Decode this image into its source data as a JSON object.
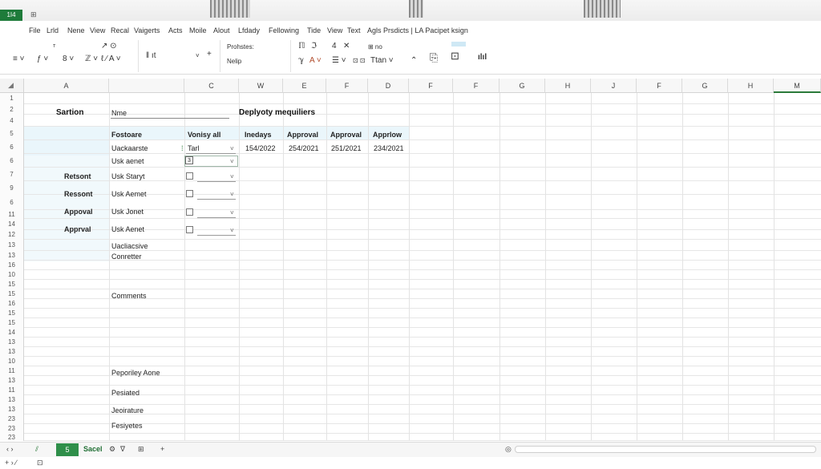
{
  "app": {
    "badge": "1I4",
    "grid_icon": "⊞"
  },
  "menu": [
    "File",
    "Lrld",
    "Nene",
    "View",
    "Recal",
    "Vaigerts",
    "Acts",
    "Moile",
    "Alout",
    "Lfdady",
    "Fellowing",
    "Tide",
    "View",
    "Text",
    "Agls Prsdicts | LA Pacipet ksign"
  ],
  "ribbon": {
    "g1": [
      "≡ ˅",
      "ƒ ˅",
      "8 ˅",
      "ℤ ˅"
    ],
    "g1_top": [
      "ᵀ",
      "↗ ⊙",
      "ℓ ∕ A ˅"
    ],
    "g2": [
      "‖ ıt",
      "˅",
      "+"
    ],
    "g3_top": "Prohstes:",
    "g3_bot": "Nelip",
    "g4_top": [
      "ℿ",
      "ℑ",
      "4",
      "✕",
      "⊞ no"
    ],
    "g4_bot": [
      "ℽ",
      "A ˅",
      "☰ ˅",
      "⊡ ⊡",
      "Ttan ˅",
      "⌃"
    ],
    "icons": [
      "⎘",
      "⊡",
      "ılıl"
    ]
  },
  "columns": [
    "A",
    "C",
    "W",
    "E",
    "F",
    "D",
    "F",
    "F",
    "G",
    "H",
    "J",
    "F",
    "G",
    "H",
    "M"
  ],
  "rows": [
    "1",
    "2",
    "4",
    "5",
    "6",
    "6",
    "7",
    "9",
    "6",
    "11",
    "14",
    "12",
    "13",
    "13",
    "16",
    "10",
    "15",
    "15",
    "16",
    "15",
    "15",
    "14",
    "13",
    "13",
    "10",
    "11",
    "13",
    "11",
    "13",
    "13",
    "23",
    "23",
    "23"
  ],
  "sheet": {
    "section_label": "Sartion",
    "name_label": "Nme",
    "title": "Deplyoty mequiliers",
    "header_row": [
      "Fostoare",
      "Vonisy all",
      "Inedays",
      "Approval",
      "Approval",
      "Apprlow"
    ],
    "row6": {
      "label": "Uackaarste",
      "value": "Tarl",
      "dates": [
        "154/2022",
        "254/2021",
        "251/2021",
        "234/2021"
      ]
    },
    "row6b": {
      "label": "Usk aenet",
      "box": "3"
    },
    "left_labels": [
      "Retsont",
      "Ressont",
      "Appoval",
      "Apprval"
    ],
    "list_labels": [
      "Usk Staryt",
      "Usk Aemet",
      "Usk Jonet",
      "Usk Aenet"
    ],
    "extra1": "Uacliacsive",
    "extra2": "Conretter",
    "comments": "Comments",
    "footer_labels": [
      "Peporiley Aone",
      "Pesiated",
      "Jeoirature",
      "Fesiyetes"
    ]
  },
  "tabs": {
    "active": "5",
    "name": "Sacel",
    "nav_left": "‹ ›",
    "add": "+"
  },
  "status": {
    "left": "+ ›  ∕",
    "icon": "⊡"
  }
}
